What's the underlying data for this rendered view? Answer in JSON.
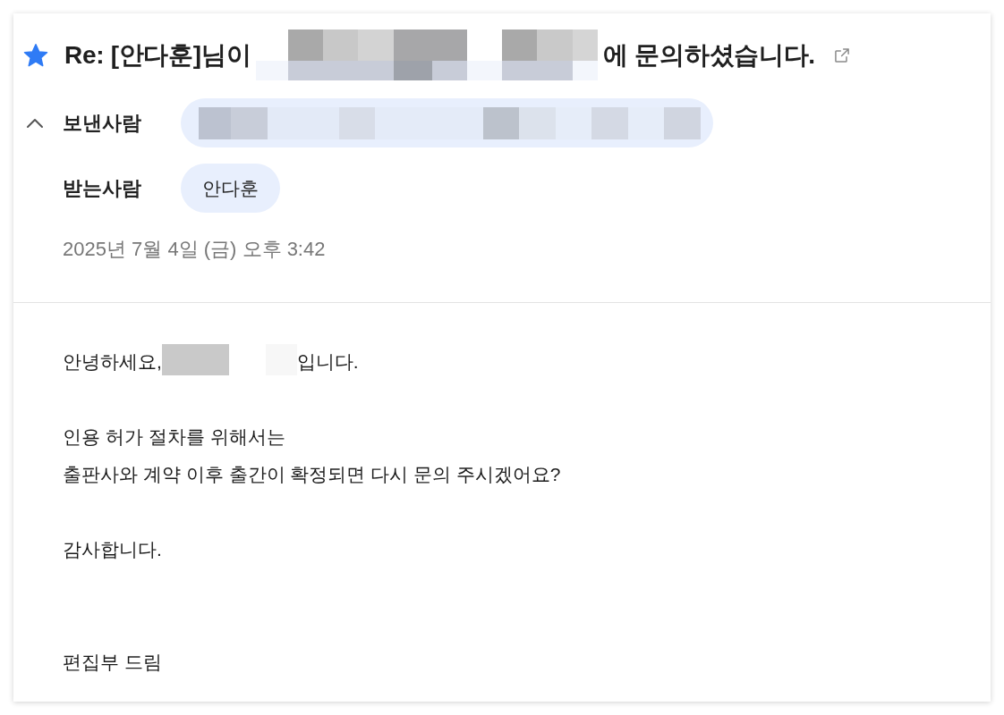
{
  "message": {
    "starred": true,
    "subject": [
      {
        "kind": "text",
        "text": "Re: [안다훈]님이"
      },
      {
        "kind": "redacted"
      },
      {
        "kind": "text",
        "text": "에 문의하셨습니다."
      }
    ],
    "sender": {
      "label": "보낸사람",
      "expanded": true,
      "chips": [
        {
          "kind": "redacted"
        }
      ]
    },
    "recipients": {
      "label": "받는사람",
      "chips": [
        {
          "kind": "name",
          "text": "안다훈"
        }
      ]
    },
    "date": "2025년 7월 4일 (금) 오후 3:42",
    "body": [
      {
        "kind": "paragraph",
        "lines": [
          [
            {
              "kind": "text",
              "text": "안녕하세요,"
            },
            {
              "kind": "redacted"
            },
            {
              "kind": "text",
              "text": "입니다."
            }
          ]
        ]
      },
      {
        "kind": "paragraph",
        "lines": [
          [
            {
              "kind": "text",
              "text": "인용 허가 절차를 위해서는"
            }
          ],
          [
            {
              "kind": "text",
              "text": "출판사와 계약 이후 출간이 확정되면 다시 문의 주시겠어요?"
            }
          ]
        ]
      },
      {
        "kind": "paragraph",
        "lines": [
          [
            {
              "kind": "text",
              "text": "감사합니다."
            }
          ]
        ]
      },
      {
        "kind": "signature",
        "lines": [
          [
            {
              "kind": "text",
              "text": "편집부 드림"
            }
          ]
        ]
      }
    ]
  }
}
